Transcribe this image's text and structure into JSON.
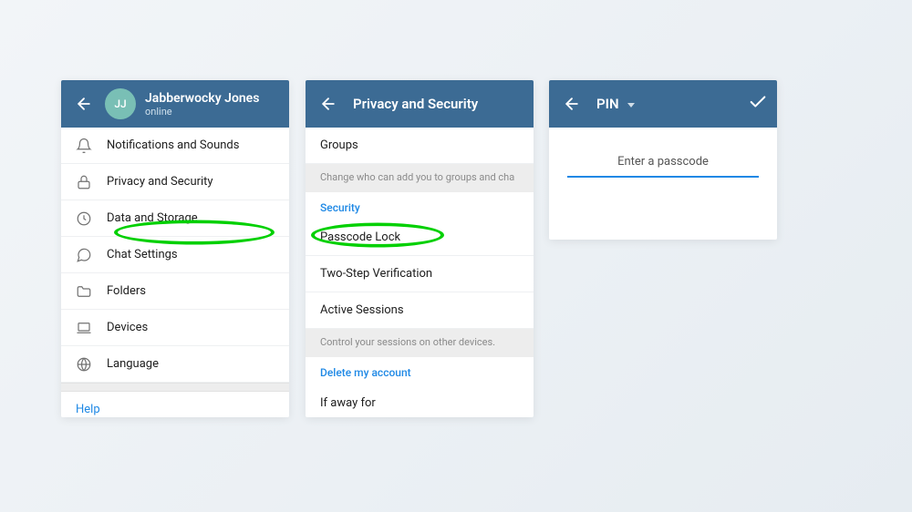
{
  "screen1": {
    "user": {
      "initials": "JJ",
      "name": "Jabberwocky Jones",
      "status": "online"
    },
    "items": [
      {
        "key": "notifications",
        "label": "Notifications and Sounds",
        "icon": "bell"
      },
      {
        "key": "privacy",
        "label": "Privacy and Security",
        "icon": "lock",
        "highlighted": true
      },
      {
        "key": "data",
        "label": "Data and Storage",
        "icon": "clock"
      },
      {
        "key": "chat",
        "label": "Chat Settings",
        "icon": "chat"
      },
      {
        "key": "folders",
        "label": "Folders",
        "icon": "folder"
      },
      {
        "key": "devices",
        "label": "Devices",
        "icon": "laptop"
      },
      {
        "key": "language",
        "label": "Language",
        "icon": "globe"
      }
    ],
    "help": "Help"
  },
  "screen2": {
    "title": "Privacy and Security",
    "groups_label": "Groups",
    "groups_hint": "Change who can add you to groups and cha",
    "security_header": "Security",
    "security_items": [
      {
        "label": "Passcode Lock",
        "highlighted": true
      },
      {
        "label": "Two-Step Verification"
      },
      {
        "label": "Active Sessions"
      }
    ],
    "sessions_hint": "Control your sessions on other devices.",
    "delete_header": "Delete my account",
    "delete_item": "If away for"
  },
  "screen3": {
    "mode": "PIN",
    "prompt": "Enter a passcode"
  }
}
